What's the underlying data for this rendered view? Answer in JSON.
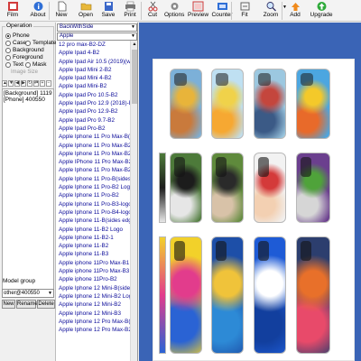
{
  "toolbar": {
    "items": [
      {
        "label": "Film",
        "icon": "film-icon"
      },
      {
        "label": "About",
        "icon": "info-icon"
      },
      {
        "label": "New",
        "icon": "new-file-icon"
      },
      {
        "label": "Open",
        "icon": "open-folder-icon"
      },
      {
        "label": "Save",
        "icon": "save-icon"
      },
      {
        "label": "Print",
        "icon": "print-icon"
      },
      {
        "label": "Cut",
        "icon": "cut-icon"
      },
      {
        "label": "Options",
        "icon": "options-icon"
      },
      {
        "label": "Preview",
        "icon": "preview-icon"
      },
      {
        "label": "Counter",
        "icon": "counter-icon"
      },
      {
        "label": "Fit",
        "icon": "fit-icon"
      },
      {
        "label": "Zoom",
        "icon": "zoom-icon"
      },
      {
        "label": "Add",
        "icon": "add-icon"
      },
      {
        "label": "Upgrade",
        "icon": "upgrade-icon"
      }
    ]
  },
  "operation": {
    "title": "Operation",
    "phone": "Phone",
    "case": "Case",
    "template": "Template",
    "background": "Background",
    "foreground": "Foreground",
    "text": "Text",
    "mask": "Mask",
    "image_size": "Image Size",
    "selected": "Phone"
  },
  "layers": [
    "[Background] 1119",
    "[Phone] 400550"
  ],
  "model_group": {
    "label": "Model group",
    "value": "other@400550",
    "buttons": [
      "New",
      "Rename",
      "Delete"
    ]
  },
  "list_panel": {
    "type_combo": "BackWithSide",
    "brand_combo": "Apple",
    "models": [
      "12 pro max-B2-DZ",
      "Apple Ipad 4-B2",
      "Apple Ipad Air 10.5 (2019)(wifi)",
      "Apple Ipad Mini 2-B2",
      "Apple Ipad Mini 4-B2",
      "Apple Ipad Mini-B2",
      "Apple Ipad Pro 10.5-B2",
      "Apple Ipad Pro 12.9 (2018)-B2",
      "Apple Ipad Pro 12.9-B2",
      "Apple Ipad Pro 9.7-B2",
      "Apple Ipad Pro-B2",
      "Apple Iphone 11 Pro Max-B(sides",
      "Apple Iphone 11 Pro Max-B2 Logo",
      "Apple Iphone 11 Pro Max-B2 Logo",
      "Apple IPhone 11 Pro Max-B2 Logo",
      "Apple Iphone 11 Pro Max-B2",
      "Apple Iphone 11 Pro-B(sides edg",
      "Apple Iphone 11 Pro-B2 Logo",
      "Apple Iphone 11 Pro-B2",
      "Apple Iphone 11 Pro-B3-logo",
      "Apple Iphone 11 Pro-B4-logo",
      "Apple Iphone 11-B(sides edges)",
      "Apple Iphone 11-B2 Logo",
      "Apple Iphone 11-B2-1",
      "Apple Iphone 11-B2",
      "Apple Iphone 11-B3",
      "Apple iphone 11Pro Max-B1",
      "Apple iphone 11Pro Max-B3",
      "Apple iphone 11Pro-B2",
      "Apple Iphone 12 Mini-B(sides edg",
      "Apple Iphone 12 Mini-B2 Logo",
      "Apple Iphone 12 Mini-B2",
      "Apple Iphone 12 Mini-B3",
      "Apple Iphone 12 Pro Max-B(sides",
      "Apple Iphone 12 Pro Max-B2 Logo"
    ]
  },
  "colors": {
    "canvas_bg": "#3a64b6",
    "list_text": "#0b0b99",
    "toolbar_bg": "#f3f3f3"
  },
  "skins": [
    {
      "name": "photo-skin-sunflower-girl",
      "palette": [
        "#7cb0d8",
        "#e8b43a",
        "#c97a3c"
      ]
    },
    {
      "name": "photo-skin-yellow-dress-girl",
      "palette": [
        "#bfe0f2",
        "#f0d24a",
        "#f6a832"
      ]
    },
    {
      "name": "photo-skin-family",
      "palette": [
        "#9cc8e0",
        "#c4463d",
        "#3b5a86"
      ]
    },
    {
      "name": "photo-skin-yellow-cartoon",
      "palette": [
        "#4ca6e0",
        "#f4c92a",
        "#e86a2a"
      ]
    },
    {
      "name": "photo-skin-dog-side",
      "palette": [
        "#4d7a3a",
        "#1c1c1c",
        "#e6e6e6"
      ]
    },
    {
      "name": "photo-skin-girl-dog",
      "palette": [
        "#5f8a3c",
        "#2a2a2a",
        "#d8c2a8"
      ]
    },
    {
      "name": "photo-skin-baby-santa",
      "palette": [
        "#f2f2f2",
        "#d43a3a",
        "#f3d0b2"
      ]
    },
    {
      "name": "photo-skin-joker",
      "palette": [
        "#6b3f8e",
        "#4fa33a",
        "#d6d6d6"
      ]
    },
    {
      "name": "photo-skin-abstract-side",
      "palette": [
        "#f2d12a",
        "#e23c8c",
        "#2a63d4"
      ]
    },
    {
      "name": "photo-skin-blue-marble",
      "palette": [
        "#1d4fa8",
        "#f0c33a",
        "#2d8ad6"
      ]
    },
    {
      "name": "photo-skin-logo-blue",
      "palette": [
        "#1e5bd6",
        "#ffffff",
        "#123f9e"
      ]
    },
    {
      "name": "photo-skin-floral",
      "palette": [
        "#2c3e6e",
        "#e8702a",
        "#e84a6a"
      ]
    }
  ]
}
